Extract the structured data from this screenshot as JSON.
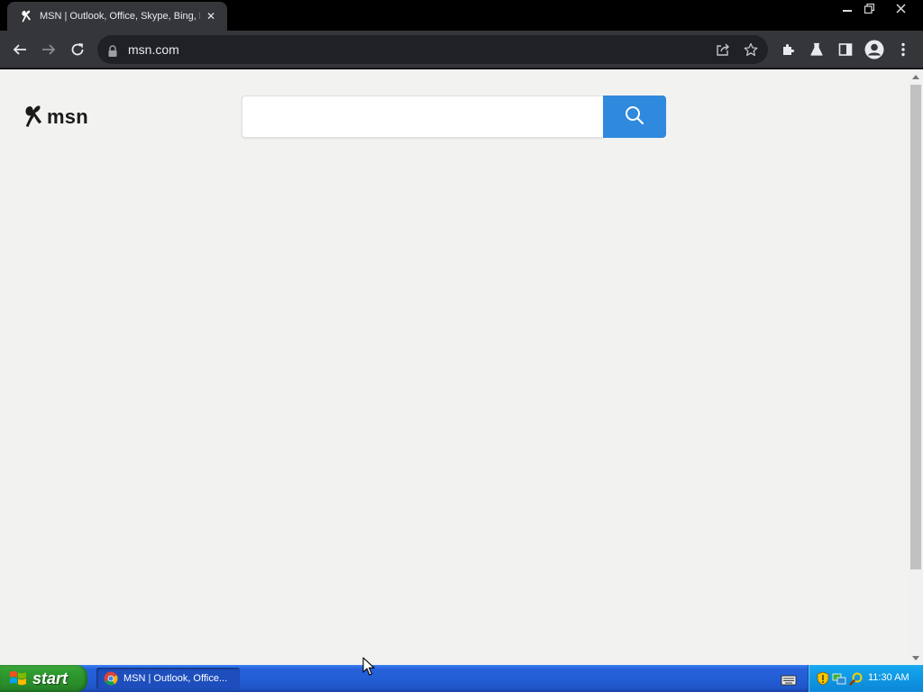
{
  "browser": {
    "tab_title": "MSN | Outlook, Office, Skype, Bing, Breaking News, and Latest Videos",
    "tab_favicon": "msn-butterfly-icon",
    "url": "msn.com",
    "theme_color": "#35363a"
  },
  "page": {
    "logo_text": "msn",
    "search_placeholder": "",
    "search_button_color": "#2f89dd",
    "background_color": "#f2f2f1"
  },
  "taskbar": {
    "start_label": "start",
    "task_label": "MSN | Outlook, Office...",
    "clock": "11:30 AM"
  }
}
